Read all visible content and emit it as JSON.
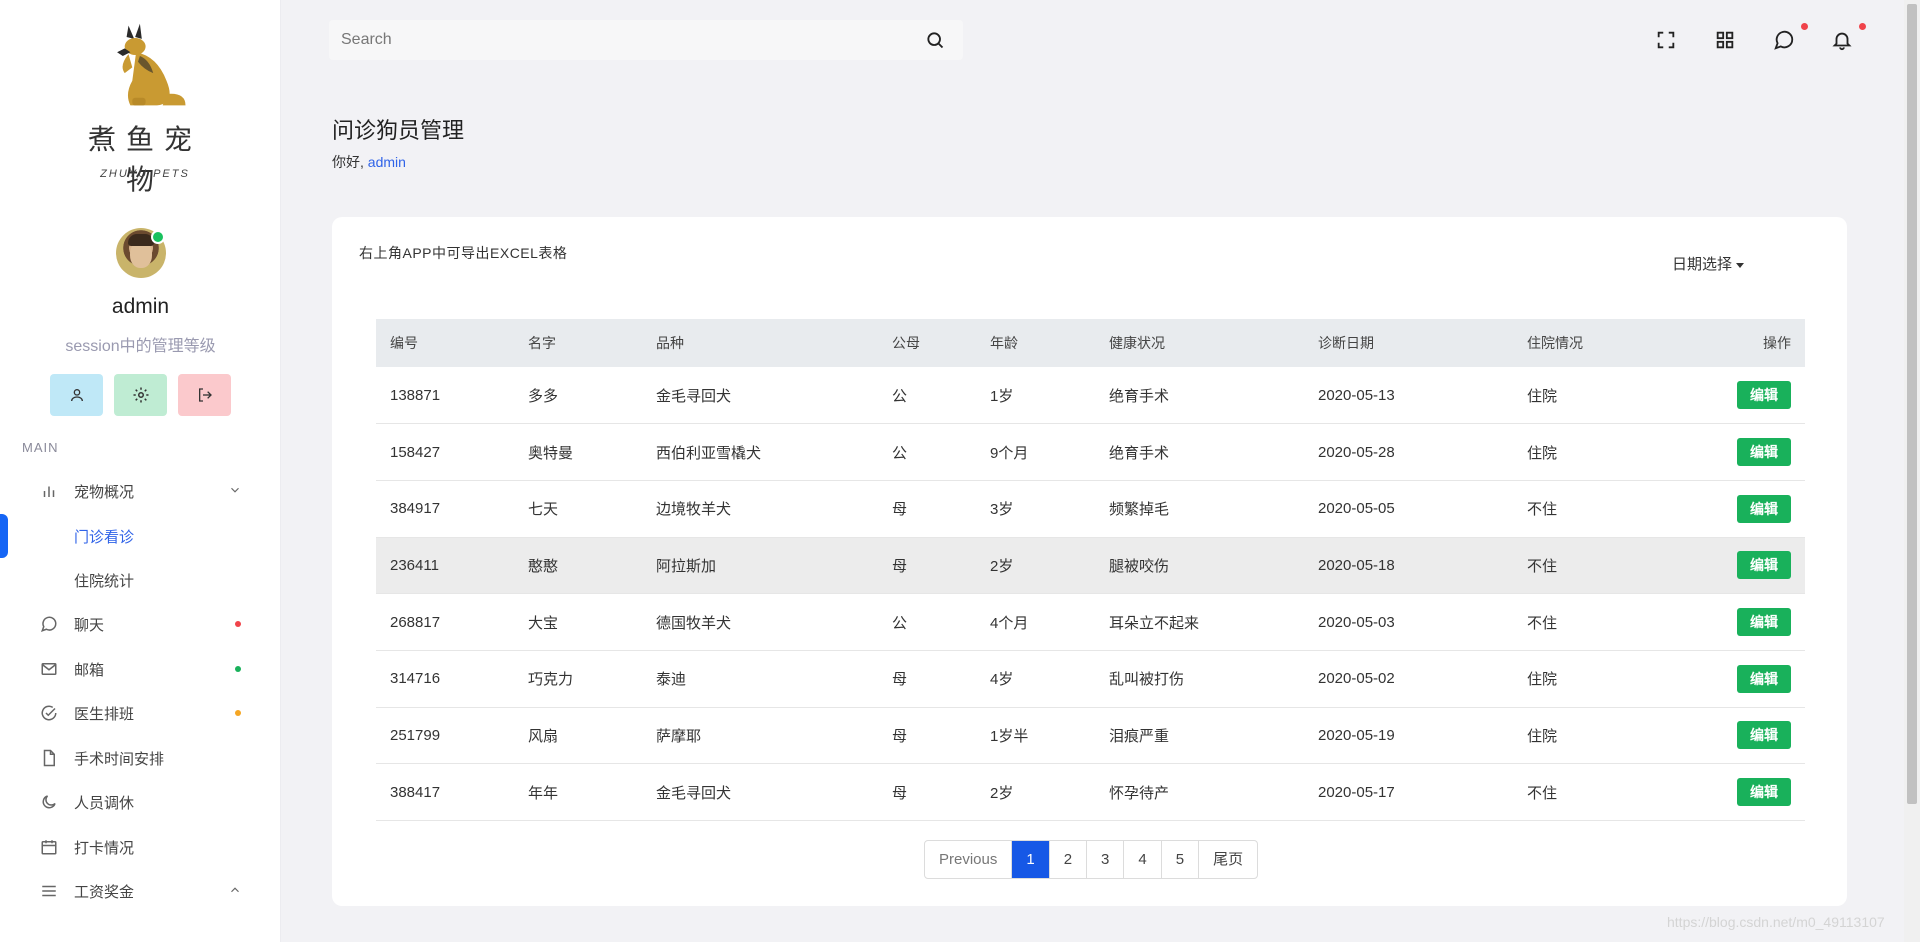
{
  "brand": {
    "name": "煮鱼宠物",
    "subtitle": "ZHUYU PETS"
  },
  "user": {
    "name": "admin",
    "role": "session中的管理等级"
  },
  "sidebar": {
    "section": "MAIN",
    "items": [
      {
        "label": "宠物概况",
        "icon": "bar-chart-icon",
        "arrow": "chevron-down-icon"
      },
      {
        "label": "聊天",
        "icon": "chat-icon",
        "dot": "#f0434a"
      },
      {
        "label": "邮箱",
        "icon": "mail-icon",
        "dot": "#19b15b"
      },
      {
        "label": "医生排班",
        "icon": "check-circle-icon",
        "dot": "#f5a623"
      },
      {
        "label": "手术时间安排",
        "icon": "file-icon"
      },
      {
        "label": "人员调休",
        "icon": "moon-icon"
      },
      {
        "label": "打卡情况",
        "icon": "calendar-icon"
      },
      {
        "label": "工资奖金",
        "icon": "menu-icon",
        "arrow": "chevron-up-icon"
      }
    ],
    "subitems": [
      {
        "label": "门诊看诊",
        "active": true
      },
      {
        "label": "住院统计"
      }
    ]
  },
  "search": {
    "placeholder": "Search"
  },
  "page": {
    "title": "问诊狗员管理",
    "greeting_prefix": "你好, ",
    "greeting_user": "admin"
  },
  "card": {
    "note": "右上角APP中可导出EXCEL表格",
    "date_select": "日期选择"
  },
  "table": {
    "columns": [
      "编号",
      "名字",
      "品种",
      "公母",
      "年龄",
      "健康状况",
      "诊断日期",
      "住院情况",
      "操作"
    ],
    "rows": [
      [
        "138871",
        "多多",
        "金毛寻回犬",
        "公",
        "1岁",
        "绝育手术",
        "2020-05-13",
        "住院"
      ],
      [
        "158427",
        "奥特曼",
        "西伯利亚雪橇犬",
        "公",
        "9个月",
        "绝育手术",
        "2020-05-28",
        "住院"
      ],
      [
        "384917",
        "七天",
        "边境牧羊犬",
        "母",
        "3岁",
        "频繁掉毛",
        "2020-05-05",
        "不住"
      ],
      [
        "236411",
        "憨憨",
        "阿拉斯加",
        "母",
        "2岁",
        "腿被咬伤",
        "2020-05-18",
        "不住"
      ],
      [
        "268817",
        "大宝",
        "德国牧羊犬",
        "公",
        "4个月",
        "耳朵立不起来",
        "2020-05-03",
        "不住"
      ],
      [
        "314716",
        "巧克力",
        "泰迪",
        "母",
        "4岁",
        "乱叫被打伤",
        "2020-05-02",
        "住院"
      ],
      [
        "251799",
        "风扇",
        "萨摩耶",
        "母",
        "1岁半",
        "泪痕严重",
        "2020-05-19",
        "住院"
      ],
      [
        "388417",
        "年年",
        "金毛寻回犬",
        "母",
        "2岁",
        "怀孕待产",
        "2020-05-17",
        "不住"
      ]
    ],
    "action_label": "编辑"
  },
  "pagination": {
    "previous": "Previous",
    "pages": [
      "1",
      "2",
      "3",
      "4",
      "5"
    ],
    "current": "1",
    "last": "尾页"
  },
  "watermark": "https://blog.csdn.net/m0_49113107"
}
